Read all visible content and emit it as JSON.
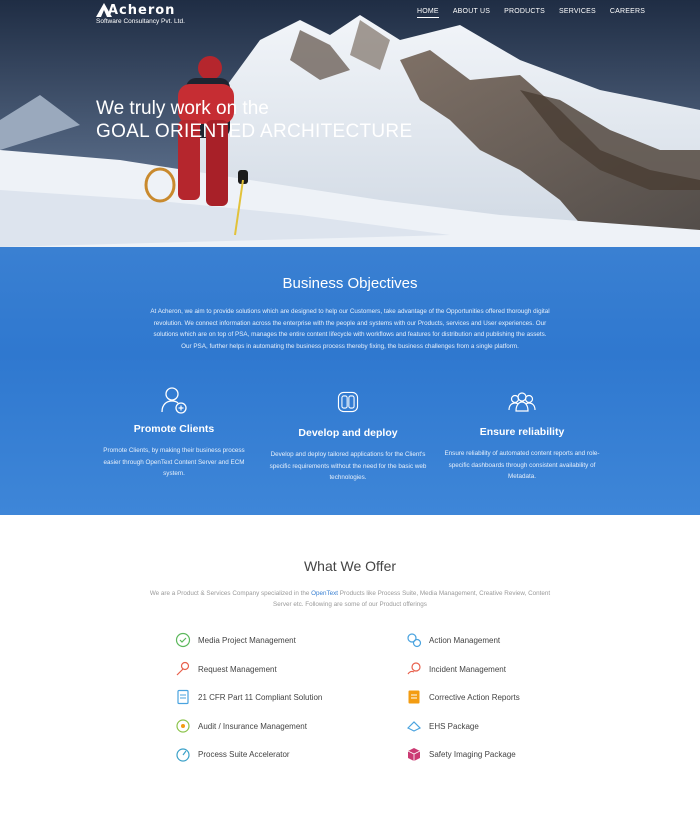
{
  "header": {
    "logo_name": "Acheron",
    "logo_subtitle": "Software Consultancy Pvt. Ltd.",
    "nav": [
      {
        "label": "HOME",
        "active": true
      },
      {
        "label": "ABOUT US",
        "active": false
      },
      {
        "label": "PRODUCTS",
        "active": false
      },
      {
        "label": "SERVICES",
        "active": false
      },
      {
        "label": "CAREERS",
        "active": false
      }
    ]
  },
  "hero": {
    "line1": "We truly work on the",
    "line2": "GOAL ORIENTED ARCHITECTURE"
  },
  "objectives": {
    "title": "Business Objectives",
    "text": "At Acheron, we aim to provide solutions which are designed to help our Customers, take advantage of the Opportunities offered thorough digital revolution. We connect information across the enterprise with the people and systems with our Products, services and User experiences. Our solutions which are on top of PSA, manages the entire content lifecycle with workflows and features for distribution and publishing the assets. Our PSA, further helps in automating the business process thereby fixing, the business challenges from a single platform.",
    "columns": [
      {
        "icon": "user-plus-icon",
        "title": "Promote Clients",
        "text": "Promote Clients, by making their business process easier through OpenText Content Server and ECM system."
      },
      {
        "icon": "devices-icon",
        "title": "Develop and deploy",
        "text": "Develop and deploy tailored applications for the Client's specific requirements without the need for the basic web technologies."
      },
      {
        "icon": "users-group-icon",
        "title": "Ensure reliability",
        "text": "Ensure reliability of automated content reports and role-specific dashboards through consistent availability of Metadata."
      }
    ]
  },
  "offer": {
    "title": "What We Offer",
    "text_before": "We are a Product & Services Company specialized in the ",
    "text_link": "OpenText",
    "text_after": " Products like Process Suite, Media Management, Creative Review, Content Server etc. Following are some of our Product offerings",
    "left_items": [
      {
        "label": "Media Project Management",
        "icon": "media-project-icon",
        "color": "#5cb85c"
      },
      {
        "label": "Request Management",
        "icon": "request-icon",
        "color": "#e8604c"
      },
      {
        "label": "21 CFR Part 11 Compliant Solution",
        "icon": "document-icon",
        "color": "#4aa3df"
      },
      {
        "label": "Audit / Insurance Management",
        "icon": "audit-icon",
        "color": "#8bc34a"
      },
      {
        "label": "Process Suite Accelerator",
        "icon": "speedometer-icon",
        "color": "#3aa0c8"
      }
    ],
    "right_items": [
      {
        "label": "Action Management",
        "icon": "action-icon",
        "color": "#4aa3df"
      },
      {
        "label": "Incident Management",
        "icon": "incident-icon",
        "color": "#e8604c"
      },
      {
        "label": "Corrective Action Reports",
        "icon": "report-icon",
        "color": "#f39c12"
      },
      {
        "label": "EHS Package",
        "icon": "ehs-icon",
        "color": "#4aa3df"
      },
      {
        "label": "Safety Imaging Package",
        "icon": "package-icon",
        "color": "#c2185b"
      }
    ]
  }
}
